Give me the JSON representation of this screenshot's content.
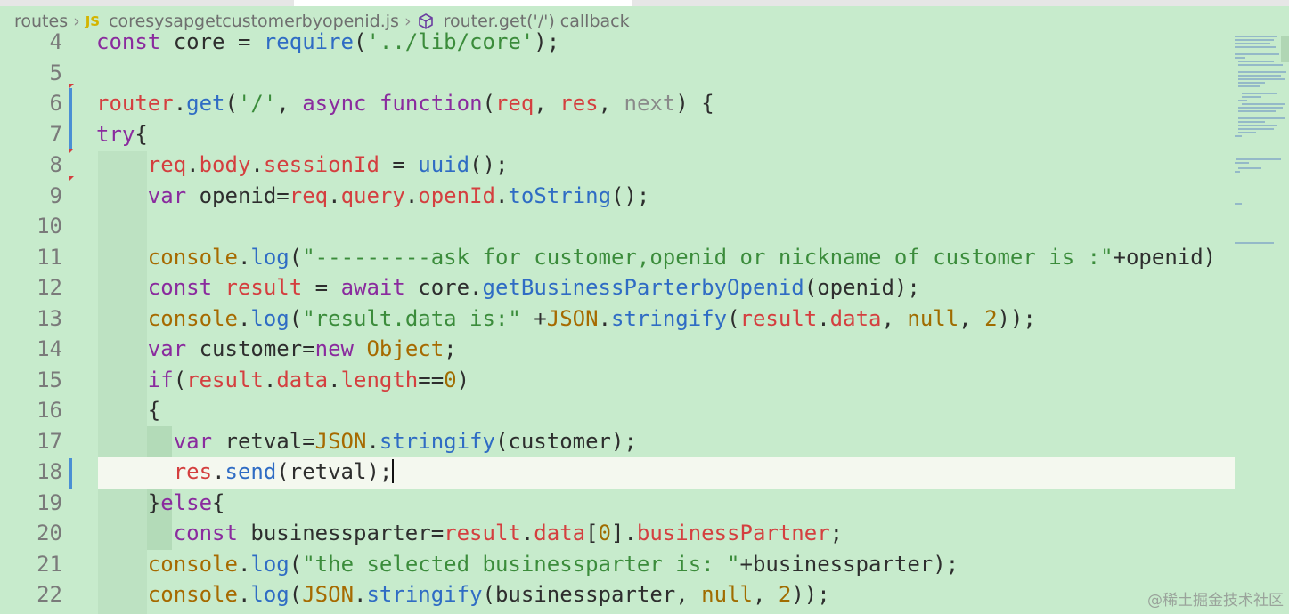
{
  "breadcrumb": {
    "folder": "routes",
    "file_badge": "JS",
    "file": "coresysapgetcustomerbyopenid.js",
    "symbol": "router.get('/') callback"
  },
  "icons": {
    "chevron": "chevron-right-icon",
    "js_file": "javascript-file-icon",
    "symbol": "method-cube-icon"
  },
  "colors": {
    "background": "#c7ebcc",
    "current_line": "#f4f8ef",
    "keyword": "#8a2b9e",
    "variable": "#d43f3f",
    "function": "#2f6cc4",
    "string": "#3b8c3b",
    "number": "#a06c00"
  },
  "editor": {
    "current_line": "18",
    "lines": [
      {
        "num": "4",
        "text": "const core = require('../lib/core');"
      },
      {
        "num": "5",
        "text": ""
      },
      {
        "num": "6",
        "text": "router.get('/', async function(req, res, next) {"
      },
      {
        "num": "7",
        "text": "try{"
      },
      {
        "num": "8",
        "text": "    req.body.sessionId = uuid();"
      },
      {
        "num": "9",
        "text": "    var openid=req.query.openId.toString();"
      },
      {
        "num": "10",
        "text": ""
      },
      {
        "num": "11",
        "text": "    console.log(\"---------ask for customer,openid or nickname of customer is :\"+openid)"
      },
      {
        "num": "12",
        "text": "    const result = await core.getBusinessParterbyOpenid(openid);"
      },
      {
        "num": "13",
        "text": "    console.log(\"result.data is:\" +JSON.stringify(result.data, null, 2));"
      },
      {
        "num": "14",
        "text": "    var customer=new Object;"
      },
      {
        "num": "15",
        "text": "    if(result.data.length==0)"
      },
      {
        "num": "16",
        "text": "    {"
      },
      {
        "num": "17",
        "text": "      var retval=JSON.stringify(customer);"
      },
      {
        "num": "18",
        "text": "      res.send(retval);"
      },
      {
        "num": "19",
        "text": "    }else{"
      },
      {
        "num": "20",
        "text": "      const businessparter=result.data[0].businessPartner;"
      },
      {
        "num": "21",
        "text": "    console.log(\"the selected businessparter is: \"+businessparter);"
      },
      {
        "num": "22",
        "text": "    console.log(JSON.stringify(businessparter, null, 2));"
      }
    ]
  },
  "watermark": "@稀土掘金技术社区"
}
